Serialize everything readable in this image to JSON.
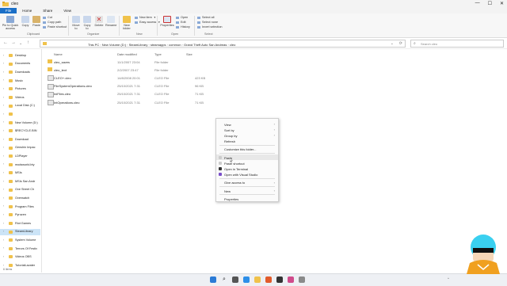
{
  "window": {
    "title": "cleo",
    "controls": [
      "—",
      "☐",
      "✕"
    ]
  },
  "ribbon_tabs": [
    "File",
    "Home",
    "Share",
    "View"
  ],
  "ribbon": {
    "pin_label": "Pin to Quick access",
    "copy_label": "Copy",
    "paste_label": "Paste",
    "cut_label": "Cut",
    "copy_path_label": "Copy path",
    "paste_shortcut_label": "Paste shortcut",
    "move_to_label": "Move to",
    "copy_to_label": "Copy to",
    "delete_label": "Delete",
    "rename_label": "Rename",
    "new_folder_label": "New folder",
    "new_item_label": "New item",
    "easy_access_label": "Easy access",
    "properties_label": "Properties",
    "open_label": "Open",
    "edit_label": "Edit",
    "history_label": "History",
    "select_all_label": "Select all",
    "select_none_label": "Select none",
    "invert_selection_label": "Invert selection",
    "groups": [
      "Clipboard",
      "Organize",
      "New",
      "Open",
      "Select"
    ]
  },
  "address": {
    "breadcrumbs": [
      "This PC",
      "New Volume (D:)",
      "SteamLibrary",
      "steamapps",
      "common",
      "Grand Theft Auto San Andreas",
      "cleo"
    ],
    "search_placeholder": "Search cleo"
  },
  "sidebar": {
    "items": [
      {
        "label": "Desktop",
        "selected": false
      },
      {
        "label": "Documents",
        "selected": false
      },
      {
        "label": "Downloads",
        "selected": false
      },
      {
        "label": "Music",
        "selected": false
      },
      {
        "label": "Pictures",
        "selected": false
      },
      {
        "label": "Videos",
        "selected": false
      },
      {
        "label": "Local Disk (C:)",
        "selected": false
      },
      {
        "label": "",
        "selected": false
      },
      {
        "label": "New Volume (D:)",
        "selected": false
      },
      {
        "label": "$RECYCLE.BIN",
        "selected": false
      },
      {
        "label": "Download",
        "selected": false
      },
      {
        "label": "Genshin Impac",
        "selected": false
      },
      {
        "label": "LDPlayer",
        "selected": false
      },
      {
        "label": "modsworld.bty",
        "selected": false
      },
      {
        "label": "MSIs",
        "selected": false
      },
      {
        "label": "MSIs San Andr",
        "selected": false
      },
      {
        "label": "Ove Street Ch",
        "selected": false
      },
      {
        "label": "Overwatch",
        "selected": false
      },
      {
        "label": "Program Files",
        "selected": false
      },
      {
        "label": "Pyrozen",
        "selected": false
      },
      {
        "label": "Riot Games",
        "selected": false
      },
      {
        "label": "SteamLibrary",
        "selected": true
      },
      {
        "label": "System Volume",
        "selected": false
      },
      {
        "label": "Terrors Of Festiv",
        "selected": false
      },
      {
        "label": "Videos OBS",
        "selected": false
      },
      {
        "label": "TutorialLavater",
        "selected": false
      }
    ]
  },
  "columns": {
    "name": "Name",
    "date": "Date modified",
    "type": "Type",
    "size": "Size"
  },
  "files": [
    {
      "name": "cleo_saves",
      "date": "11/1/2007 23:04",
      "type": "File folder",
      "size": "",
      "kind": "folder"
    },
    {
      "name": "cleo_text",
      "date": "2/2/2007 23:47",
      "type": "File folder",
      "size": "",
      "kind": "folder"
    },
    {
      "name": "CLEO+.cleo",
      "date": "14/8/2008 20:01",
      "type": "CLEO File",
      "size": "423 KB",
      "kind": "file"
    },
    {
      "name": "FileSystemOperations.cleo",
      "date": "25/10/2021 7:31",
      "type": "CLEO File",
      "size": "96 KB",
      "kind": "file"
    },
    {
      "name": "IniFiles.cleo",
      "date": "25/10/2021 7:31",
      "type": "CLEO File",
      "size": "71 KB",
      "kind": "file"
    },
    {
      "name": "IntOperations.cleo",
      "date": "25/10/2021 7:31",
      "type": "CLEO File",
      "size": "71 KB",
      "kind": "file"
    }
  ],
  "context_menu": {
    "group1": [
      {
        "label": "View",
        "submenu": true
      },
      {
        "label": "Sort by",
        "submenu": true
      },
      {
        "label": "Group by",
        "submenu": true
      },
      {
        "label": "Refresh",
        "submenu": false
      }
    ],
    "group2": [
      {
        "label": "Customize this folder...",
        "submenu": false
      }
    ],
    "group3": [
      {
        "label": "Paste",
        "submenu": false,
        "highlighted": true
      },
      {
        "label": "Paste shortcut",
        "submenu": false
      },
      {
        "label": "Open in Terminal",
        "submenu": false
      },
      {
        "label": "Open with Visual Studio",
        "submenu": false
      }
    ],
    "group4": [
      {
        "label": "Give access to",
        "submenu": true
      }
    ],
    "group5": [
      {
        "label": "New",
        "submenu": true
      }
    ],
    "group6": [
      {
        "label": "Properties",
        "submenu": false
      }
    ]
  },
  "status": {
    "count": "6 items"
  },
  "colors": {
    "accent": "#1a6fc7",
    "folder": "#f0c24b",
    "selection": "#cce4f7"
  }
}
